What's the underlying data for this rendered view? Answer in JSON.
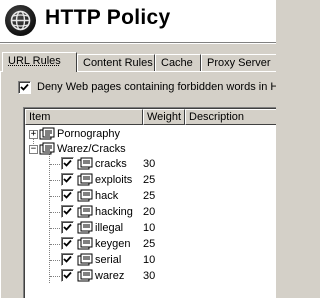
{
  "header": {
    "title": "HTTP Policy",
    "logo_icon": "globe-icon"
  },
  "tabs": [
    {
      "label": "URL Rules",
      "active": true
    },
    {
      "label": "Content Rules",
      "active": false
    },
    {
      "label": "Cache",
      "active": false
    },
    {
      "label": "Proxy Server",
      "active": false
    }
  ],
  "deny_option": {
    "label": "Deny Web pages containing forbidden words in HTML",
    "checked": true
  },
  "columns": {
    "item": "Item",
    "weight": "Weight",
    "description": "Description"
  },
  "tree": {
    "groups": [
      {
        "label": "Pornography",
        "expanded": false
      },
      {
        "label": "Warez/Cracks",
        "expanded": true
      }
    ],
    "items": [
      {
        "label": "cracks",
        "weight": "30",
        "checked": true
      },
      {
        "label": "exploits",
        "weight": "25",
        "checked": true
      },
      {
        "label": "hack",
        "weight": "25",
        "checked": true
      },
      {
        "label": "hacking",
        "weight": "20",
        "checked": true
      },
      {
        "label": "illegal",
        "weight": "10",
        "checked": true
      },
      {
        "label": "keygen",
        "weight": "25",
        "checked": true
      },
      {
        "label": "serial",
        "weight": "10",
        "checked": true
      },
      {
        "label": "warez",
        "weight": "30",
        "checked": true
      }
    ]
  },
  "colors": {
    "window_bg": "#d4d0c8",
    "list_bg": "#ffffff",
    "header_bg": "#ffffff"
  }
}
